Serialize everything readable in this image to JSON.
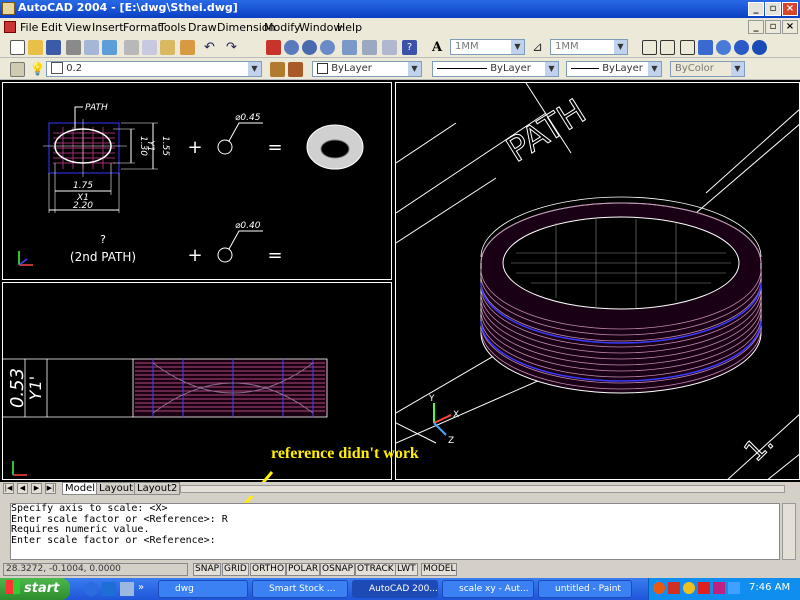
{
  "window": {
    "title": "AutoCAD 2004 - [E:\\dwg\\Sthei.dwg]"
  },
  "menu": [
    "File",
    "Edit",
    "View",
    "Insert",
    "Format",
    "Tools",
    "Draw",
    "Dimension",
    "Modify",
    "Window",
    "Help"
  ],
  "toolbar1": {
    "combo_left": "1MM",
    "combo_right": "1MM"
  },
  "layers_toolbar": {
    "layer": "0.2",
    "color": "ByLayer",
    "linetype": "ByLayer",
    "lineweight": "ByLayer",
    "plotstyle": "ByColor"
  },
  "viewport_top_left": {
    "path_label": "PATH",
    "dim_130": "1.30",
    "dim_y1": "Y1",
    "dim_155": "1.55",
    "dim_175": "1.75",
    "dim_x1": "X1",
    "dim_220": "2.20",
    "circle1_dia": "⌀0.45",
    "circle2_dia": "⌀0.40",
    "plus": "+",
    "equals": "=",
    "question": "?",
    "second_path": "(2nd PATH)"
  },
  "viewport_bottom_left": {
    "dim_053": "0.53",
    "dim_y1": "Y1'"
  },
  "viewport_right": {
    "path_label": "PATH",
    "corner_label": "1."
  },
  "ucs": {
    "x": "X",
    "y": "Y",
    "z": "Z"
  },
  "tabs": [
    "Model",
    "Layout1",
    "Layout2"
  ],
  "annotation": "reference didn't work",
  "command_lines": [
    "Specify axis to scale: <X>",
    "Enter scale factor or <Reference>: R",
    "Requires numeric value.",
    "",
    "Enter scale factor or <Reference>:"
  ],
  "status": {
    "coords": "28.3272, -0.1004, 0.0000",
    "toggles": [
      "SNAP",
      "GRID",
      "ORTHO",
      "POLAR",
      "OSNAP",
      "OTRACK",
      "LWT",
      "MODEL"
    ]
  },
  "taskbar": {
    "start": "start",
    "tasks": [
      "dwg",
      "Smart Stock ...",
      "AutoCAD 200...",
      "scale xy - Aut...",
      "untitled - Paint"
    ],
    "time": "7:46 AM"
  },
  "colors": {
    "title_blue": "#0a3fc4",
    "drawing_bg": "#000000",
    "annotation": "#ffee00",
    "start_green": "#2d8c2d"
  }
}
